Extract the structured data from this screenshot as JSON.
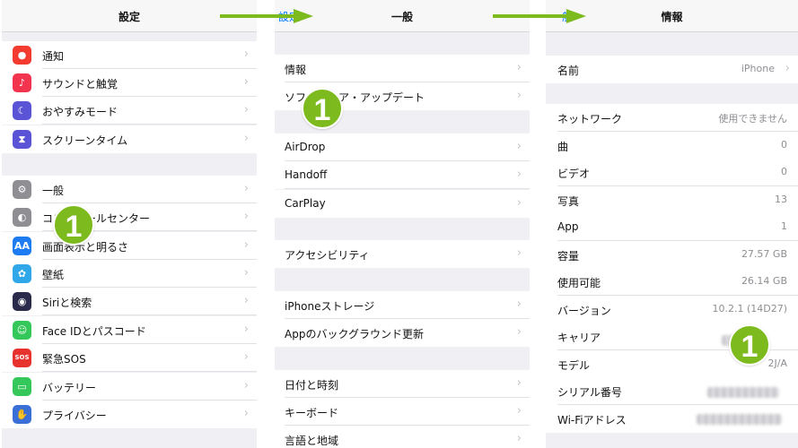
{
  "panel1": {
    "title": "設定",
    "items": [
      {
        "label": "通知",
        "icon": "notifications-icon",
        "color": "#f33b30",
        "glyph": "●"
      },
      {
        "label": "サウンドと触覚",
        "icon": "sound-icon",
        "color": "#f3344f",
        "glyph": "♪"
      },
      {
        "label": "おやすみモード",
        "icon": "moon-icon",
        "color": "#5a53d6",
        "glyph": "☾"
      },
      {
        "label": "スクリーンタイム",
        "icon": "hourglass-icon",
        "color": "#5a53d6",
        "glyph": "⧗"
      },
      {
        "label": "一般",
        "icon": "gear-icon",
        "color": "#8e8e93",
        "glyph": "⚙"
      },
      {
        "label": "コントロールセンター",
        "icon": "control-center-icon",
        "color": "#8e8e93",
        "glyph": "◐"
      },
      {
        "label": "画面表示と明るさ",
        "icon": "display-icon",
        "color": "#1e7cf2",
        "glyph": "AA"
      },
      {
        "label": "壁紙",
        "icon": "wallpaper-icon",
        "color": "#2fa7e8",
        "glyph": "✿"
      },
      {
        "label": "Siriと検索",
        "icon": "siri-icon",
        "color": "#2a2a4a",
        "glyph": "◉"
      },
      {
        "label": "Face IDとパスコード",
        "icon": "face-id-icon",
        "color": "#34c759",
        "glyph": "☺"
      },
      {
        "label": "緊急SOS",
        "icon": "sos-icon",
        "color": "#e8322d",
        "glyph": "SOS"
      },
      {
        "label": "バッテリー",
        "icon": "battery-icon",
        "color": "#34c759",
        "glyph": "▭"
      },
      {
        "label": "プライバシー",
        "icon": "hand-icon",
        "color": "#3a6fd8",
        "glyph": "✋"
      }
    ]
  },
  "panel2": {
    "title": "一般",
    "back": "設定",
    "items": [
      {
        "label": "情報"
      },
      {
        "label": "ソフトウェア・アップデート"
      },
      {
        "label": "AirDrop"
      },
      {
        "label": "Handoff"
      },
      {
        "label": "CarPlay"
      },
      {
        "label": "アクセシビリティ"
      },
      {
        "label": "iPhoneストレージ"
      },
      {
        "label": "Appのバックグラウンド更新"
      },
      {
        "label": "日付と時刻"
      },
      {
        "label": "キーボード"
      },
      {
        "label": "言語と地域"
      }
    ]
  },
  "panel3": {
    "title": "情報",
    "back": "一般",
    "name_row": {
      "label": "名前",
      "value": "iPhone"
    },
    "items": [
      {
        "label": "ネットワーク",
        "value": "使用できません"
      },
      {
        "label": "曲",
        "value": "0"
      },
      {
        "label": "ビデオ",
        "value": "0"
      },
      {
        "label": "写真",
        "value": "13"
      },
      {
        "label": "App",
        "value": "1"
      },
      {
        "label": "容量",
        "value": "27.57 GB"
      },
      {
        "label": "使用可能",
        "value": "26.14 GB"
      },
      {
        "label": "バージョン",
        "value": "10.2.1 (14D27)"
      },
      {
        "label": "キャリア",
        "value": ""
      },
      {
        "label": "モデル",
        "value": "2J/A"
      },
      {
        "label": "シリアル番号",
        "value": ""
      },
      {
        "label": "Wi-Fiアドレス",
        "value": ""
      }
    ]
  },
  "badges": {
    "step": "1"
  },
  "colors": {
    "accent": "#7dba1e",
    "link": "#007aff",
    "background": "#efeff4"
  }
}
